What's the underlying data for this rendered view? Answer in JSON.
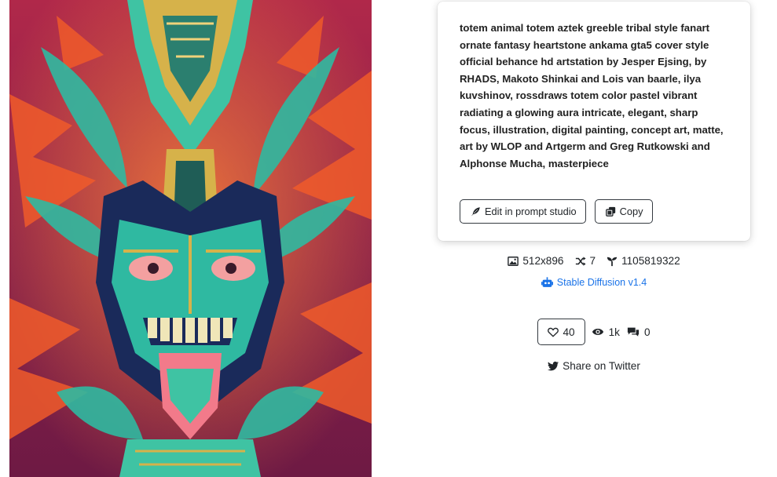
{
  "artwork": {
    "alt_icon": "totem-artwork",
    "palette": {
      "background": "#8a1f3f",
      "orange": "#f05a2a",
      "teal": "#2fb9a1",
      "green": "#5fd1a1",
      "gold": "#d6b24a",
      "navy": "#1a2a5a"
    }
  },
  "prompt": {
    "text": "totem animal totem aztek greeble tribal style fanart ornate fantasy heartstone ankama gta5 cover style official behance hd artstation by Jesper Ejsing, by RHADS, Makoto Shinkai and Lois van baarle, ilya kuvshinov, rossdraws totem color pastel vibrant radiating a glowing aura intricate, elegant, sharp focus, illustration, digital painting, concept art, matte, art by WLOP and Artgerm and Greg Rutkowski and Alphonse Mucha, masterpiece",
    "edit_button": "Edit in prompt studio",
    "copy_button": "Copy"
  },
  "meta": {
    "dimensions": "512x896",
    "steps": "7",
    "seed": "1105819322",
    "model": "Stable Diffusion v1.4"
  },
  "stats": {
    "likes": "40",
    "views": "1k",
    "comments": "0"
  },
  "share": {
    "label": "Share on Twitter"
  },
  "colors": {
    "link": "#1a73e8",
    "text": "#212529",
    "border": "#343a40"
  }
}
